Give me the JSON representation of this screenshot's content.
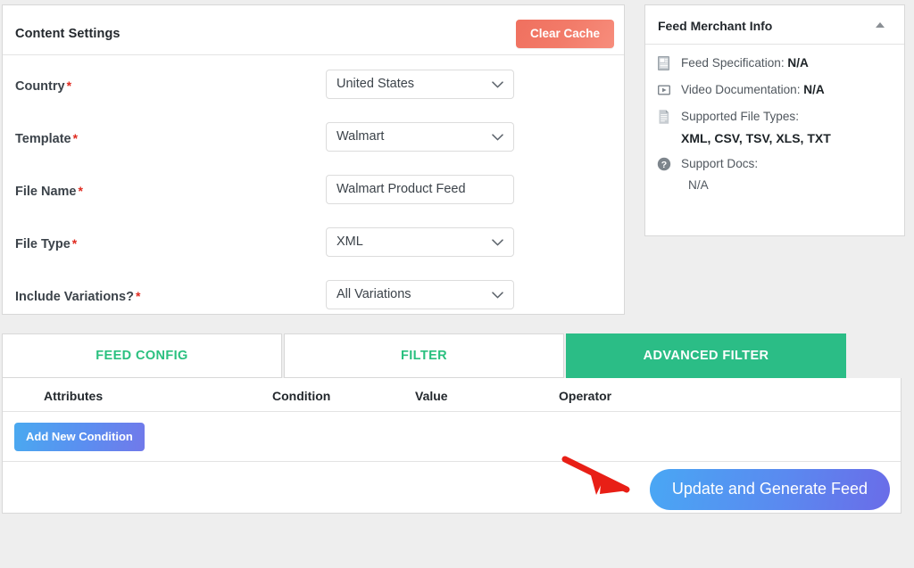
{
  "settings": {
    "title": "Content Settings",
    "clear_cache_label": "Clear Cache",
    "required_mark": "*",
    "fields": [
      {
        "label": "Country",
        "value": "United States",
        "control": "select"
      },
      {
        "label": "Template",
        "value": "Walmart",
        "control": "select"
      },
      {
        "label": "File Name",
        "value": "Walmart Product Feed",
        "control": "text"
      },
      {
        "label": "File Type",
        "value": "XML",
        "control": "select"
      },
      {
        "label": "Include Variations?",
        "value": "All Variations",
        "control": "select"
      }
    ]
  },
  "merchant": {
    "title": "Feed Merchant Info",
    "collapse_icon": "triangle-up-icon",
    "rows": [
      {
        "icon": "feed-specification-icon",
        "label": "Feed Specification:",
        "value": "N/A"
      },
      {
        "icon": "video-documentation-icon",
        "label": "Video Documentation:",
        "value": "N/A"
      },
      {
        "icon": "file-types-icon",
        "label": "Supported File Types:",
        "value": "XML, CSV, TSV, XLS, TXT"
      },
      {
        "icon": "support-docs-icon",
        "label": "Support Docs:",
        "value": "N/A"
      }
    ]
  },
  "tabs": [
    {
      "label": "FEED CONFIG",
      "active": false
    },
    {
      "label": "FILTER",
      "active": false
    },
    {
      "label": "ADVANCED FILTER",
      "active": true
    }
  ],
  "filter_table": {
    "headers": [
      "Attributes",
      "Condition",
      "Value",
      "Operator"
    ],
    "rows": [],
    "add_condition_label": "Add New Condition"
  },
  "actions": {
    "generate_label": "Update and Generate Feed",
    "annotation": "red-arrow-pointing-to-generate-button"
  },
  "colors": {
    "page_bg": "#eeeeee",
    "accent_green": "#2bbd86",
    "tab_text_green": "#2ac07f",
    "clear_cache_red": "#f2796a",
    "button_blue": "#49a7f4",
    "button_purple": "#6a6ce8",
    "required_red": "#e02b20",
    "arrow_red": "#e81f16"
  }
}
